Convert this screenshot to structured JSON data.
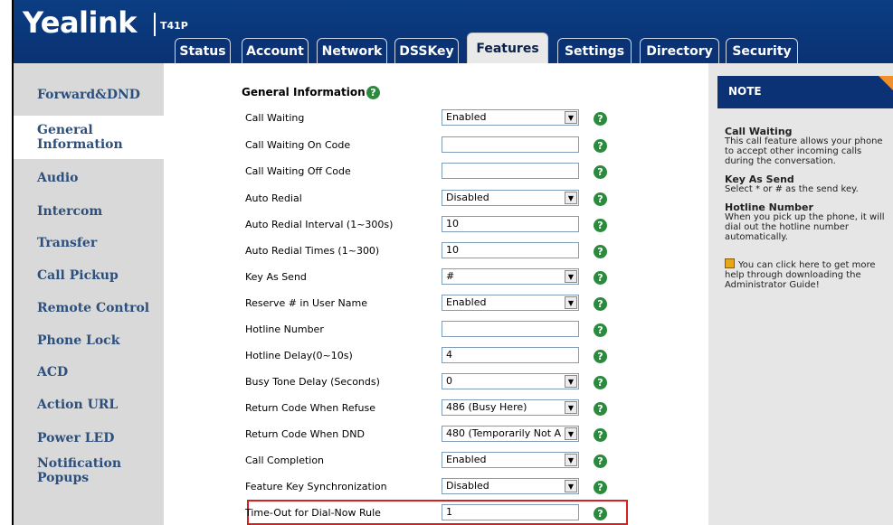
{
  "header": {
    "logo": "Yealink",
    "model": "T41P",
    "tabs": [
      "Status",
      "Account",
      "Network",
      "DSSKey",
      "Features",
      "Settings",
      "Directory",
      "Security"
    ]
  },
  "sidebar": {
    "items": [
      "Forward&DND",
      "General Information",
      "Audio",
      "Intercom",
      "Transfer",
      "Call Pickup",
      "Remote Control",
      "Phone Lock",
      "ACD",
      "Action URL",
      "Power LED",
      "Notification Popups"
    ]
  },
  "section": {
    "title": "General Information",
    "help": "?",
    "rows": [
      {
        "label": "Call Waiting",
        "value": "Enabled",
        "type": "select"
      },
      {
        "label": "Call Waiting On Code",
        "value": "",
        "type": "text"
      },
      {
        "label": "Call Waiting Off Code",
        "value": "",
        "type": "text"
      },
      {
        "label": "Auto Redial",
        "value": "Disabled",
        "type": "select"
      },
      {
        "label": "Auto Redial Interval (1~300s)",
        "value": "10",
        "type": "text"
      },
      {
        "label": "Auto Redial Times (1~300)",
        "value": "10",
        "type": "text"
      },
      {
        "label": "Key As Send",
        "value": "#",
        "type": "select"
      },
      {
        "label": "Reserve # in User Name",
        "value": "Enabled",
        "type": "select"
      },
      {
        "label": "Hotline Number",
        "value": "",
        "type": "text"
      },
      {
        "label": "Hotline Delay(0~10s)",
        "value": "4",
        "type": "text"
      },
      {
        "label": "Busy Tone Delay (Seconds)",
        "value": "0",
        "type": "select"
      },
      {
        "label": "Return Code When Refuse",
        "value": "486 (Busy Here)",
        "type": "select"
      },
      {
        "label": "Return Code When DND",
        "value": "480 (Temporarily Not A",
        "type": "select"
      },
      {
        "label": "Call Completion",
        "value": "Enabled",
        "type": "select"
      },
      {
        "label": "Feature Key Synchronization",
        "value": "Disabled",
        "type": "select"
      },
      {
        "label": "Time-Out for Dial-Now Rule",
        "value": "1",
        "type": "text"
      }
    ]
  },
  "note": {
    "title": "NOTE",
    "blocks": [
      {
        "heading": "Call Waiting",
        "text": "This call feature allows your phone to accept other incoming calls during the conversation."
      },
      {
        "heading": "Key As Send",
        "text": "Select * or # as the send key."
      },
      {
        "heading": "Hotline Number",
        "text": "When you pick up the phone, it will dial out the hotline number automatically."
      }
    ],
    "help_text": "You can click here to get more help through downloading the Administrator Guide!"
  },
  "colors": {
    "brand": "#0a3274",
    "help_icon": "#2c8a3e",
    "highlight": "#d42020",
    "note_corner": "#f0902a"
  }
}
